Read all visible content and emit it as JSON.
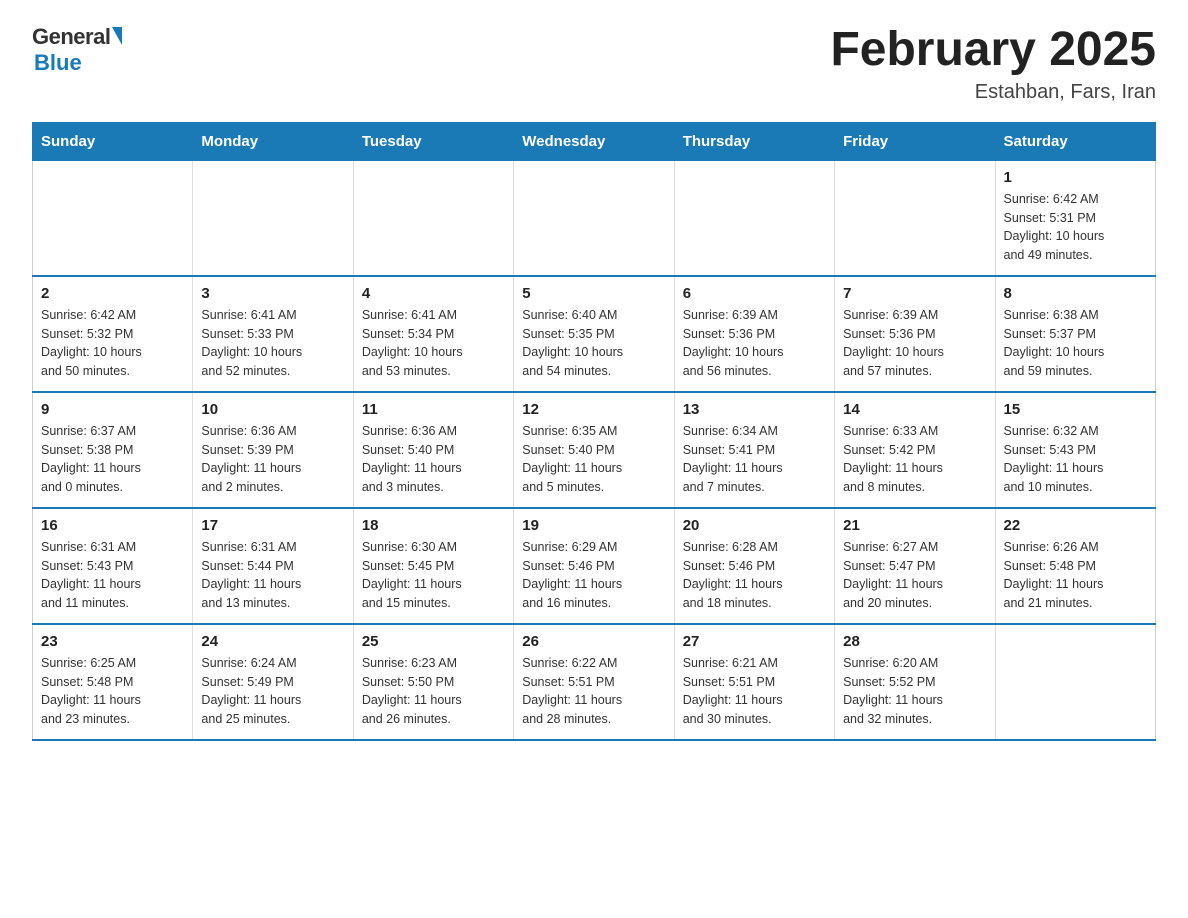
{
  "logo": {
    "general": "General",
    "blue": "Blue"
  },
  "title": "February 2025",
  "subtitle": "Estahban, Fars, Iran",
  "weekdays": [
    "Sunday",
    "Monday",
    "Tuesday",
    "Wednesday",
    "Thursday",
    "Friday",
    "Saturday"
  ],
  "weeks": [
    [
      {
        "day": "",
        "info": ""
      },
      {
        "day": "",
        "info": ""
      },
      {
        "day": "",
        "info": ""
      },
      {
        "day": "",
        "info": ""
      },
      {
        "day": "",
        "info": ""
      },
      {
        "day": "",
        "info": ""
      },
      {
        "day": "1",
        "info": "Sunrise: 6:42 AM\nSunset: 5:31 PM\nDaylight: 10 hours\nand 49 minutes."
      }
    ],
    [
      {
        "day": "2",
        "info": "Sunrise: 6:42 AM\nSunset: 5:32 PM\nDaylight: 10 hours\nand 50 minutes."
      },
      {
        "day": "3",
        "info": "Sunrise: 6:41 AM\nSunset: 5:33 PM\nDaylight: 10 hours\nand 52 minutes."
      },
      {
        "day": "4",
        "info": "Sunrise: 6:41 AM\nSunset: 5:34 PM\nDaylight: 10 hours\nand 53 minutes."
      },
      {
        "day": "5",
        "info": "Sunrise: 6:40 AM\nSunset: 5:35 PM\nDaylight: 10 hours\nand 54 minutes."
      },
      {
        "day": "6",
        "info": "Sunrise: 6:39 AM\nSunset: 5:36 PM\nDaylight: 10 hours\nand 56 minutes."
      },
      {
        "day": "7",
        "info": "Sunrise: 6:39 AM\nSunset: 5:36 PM\nDaylight: 10 hours\nand 57 minutes."
      },
      {
        "day": "8",
        "info": "Sunrise: 6:38 AM\nSunset: 5:37 PM\nDaylight: 10 hours\nand 59 minutes."
      }
    ],
    [
      {
        "day": "9",
        "info": "Sunrise: 6:37 AM\nSunset: 5:38 PM\nDaylight: 11 hours\nand 0 minutes."
      },
      {
        "day": "10",
        "info": "Sunrise: 6:36 AM\nSunset: 5:39 PM\nDaylight: 11 hours\nand 2 minutes."
      },
      {
        "day": "11",
        "info": "Sunrise: 6:36 AM\nSunset: 5:40 PM\nDaylight: 11 hours\nand 3 minutes."
      },
      {
        "day": "12",
        "info": "Sunrise: 6:35 AM\nSunset: 5:40 PM\nDaylight: 11 hours\nand 5 minutes."
      },
      {
        "day": "13",
        "info": "Sunrise: 6:34 AM\nSunset: 5:41 PM\nDaylight: 11 hours\nand 7 minutes."
      },
      {
        "day": "14",
        "info": "Sunrise: 6:33 AM\nSunset: 5:42 PM\nDaylight: 11 hours\nand 8 minutes."
      },
      {
        "day": "15",
        "info": "Sunrise: 6:32 AM\nSunset: 5:43 PM\nDaylight: 11 hours\nand 10 minutes."
      }
    ],
    [
      {
        "day": "16",
        "info": "Sunrise: 6:31 AM\nSunset: 5:43 PM\nDaylight: 11 hours\nand 11 minutes."
      },
      {
        "day": "17",
        "info": "Sunrise: 6:31 AM\nSunset: 5:44 PM\nDaylight: 11 hours\nand 13 minutes."
      },
      {
        "day": "18",
        "info": "Sunrise: 6:30 AM\nSunset: 5:45 PM\nDaylight: 11 hours\nand 15 minutes."
      },
      {
        "day": "19",
        "info": "Sunrise: 6:29 AM\nSunset: 5:46 PM\nDaylight: 11 hours\nand 16 minutes."
      },
      {
        "day": "20",
        "info": "Sunrise: 6:28 AM\nSunset: 5:46 PM\nDaylight: 11 hours\nand 18 minutes."
      },
      {
        "day": "21",
        "info": "Sunrise: 6:27 AM\nSunset: 5:47 PM\nDaylight: 11 hours\nand 20 minutes."
      },
      {
        "day": "22",
        "info": "Sunrise: 6:26 AM\nSunset: 5:48 PM\nDaylight: 11 hours\nand 21 minutes."
      }
    ],
    [
      {
        "day": "23",
        "info": "Sunrise: 6:25 AM\nSunset: 5:48 PM\nDaylight: 11 hours\nand 23 minutes."
      },
      {
        "day": "24",
        "info": "Sunrise: 6:24 AM\nSunset: 5:49 PM\nDaylight: 11 hours\nand 25 minutes."
      },
      {
        "day": "25",
        "info": "Sunrise: 6:23 AM\nSunset: 5:50 PM\nDaylight: 11 hours\nand 26 minutes."
      },
      {
        "day": "26",
        "info": "Sunrise: 6:22 AM\nSunset: 5:51 PM\nDaylight: 11 hours\nand 28 minutes."
      },
      {
        "day": "27",
        "info": "Sunrise: 6:21 AM\nSunset: 5:51 PM\nDaylight: 11 hours\nand 30 minutes."
      },
      {
        "day": "28",
        "info": "Sunrise: 6:20 AM\nSunset: 5:52 PM\nDaylight: 11 hours\nand 32 minutes."
      },
      {
        "day": "",
        "info": ""
      }
    ]
  ]
}
